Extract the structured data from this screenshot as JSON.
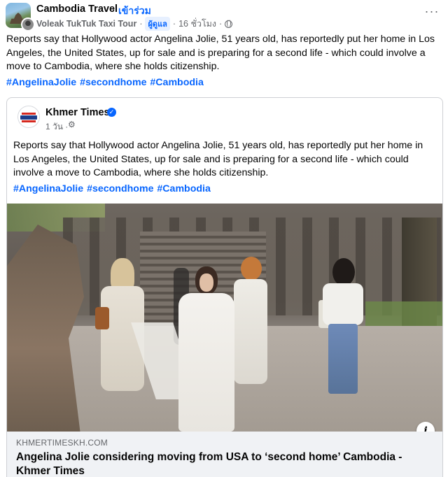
{
  "header": {
    "group_name": "Cambodia Travel",
    "separator": "·",
    "join_label": "เข้าร่วม",
    "author": "Voleak TukTuk Taxi Tour",
    "author_role": "ผู้ดูแล",
    "timestamp": "16 ชั่วโมง",
    "privacy_icon": "globe-icon",
    "more_label": "···"
  },
  "post": {
    "text": "Reports say that Hollywood actor Angelina Jolie, 51 years old, has reportedly put her home in Los Angeles, the United States, up for sale and is preparing for a second life - which could involve a move to Cambodia, where she holds citizenship.",
    "hashtags": "#AngelinaJolie #secondhome #Cambodia"
  },
  "shared": {
    "page_name": "Khmer Times",
    "verified_icon": "check-badge-icon",
    "timestamp": "1 วัน ·",
    "audience_icon": "gear-icon",
    "text": "Reports say that Hollywood actor Angelina Jolie, 51 years old, has reportedly put her home in Los Angeles, the United States, up for sale and is preparing for a second life - which could involve a move to Cambodia, where she holds citizenship.",
    "hashtags": "#AngelinaJolie #secondhome #Cambodia",
    "info_label": "i",
    "link": {
      "domain": "KHMERTIMESKH.COM",
      "title": "Angelina Jolie considering moving from USA to ‘second home’ Cambodia - Khmer Times"
    }
  },
  "colors": {
    "link_blue": "#0866ff",
    "text": "#050505",
    "secondary_text": "#65676b",
    "card_border": "#ced0d4",
    "link_background": "#f0f2f5"
  }
}
